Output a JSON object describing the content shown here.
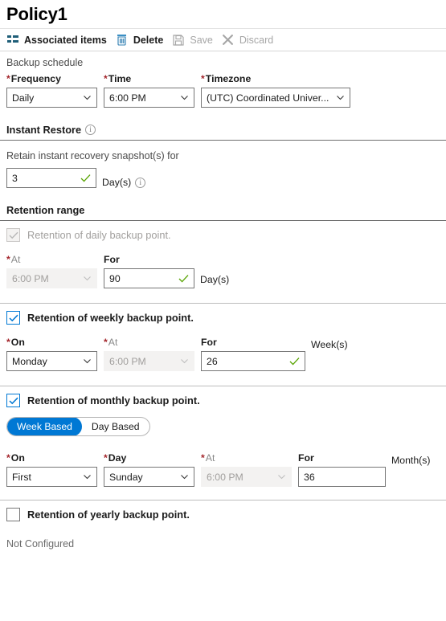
{
  "header": {
    "title": "Policy1"
  },
  "toolbar": {
    "items": [
      {
        "label": "Associated items",
        "icon": "list-icon",
        "disabled": false
      },
      {
        "label": "Delete",
        "icon": "trash-icon",
        "disabled": false
      },
      {
        "label": "Save",
        "icon": "save-icon",
        "disabled": true
      },
      {
        "label": "Discard",
        "icon": "discard-icon",
        "disabled": true
      }
    ]
  },
  "backup_schedule": {
    "section_label": "Backup schedule",
    "frequency": {
      "label": "Frequency",
      "required": true,
      "value": "Daily"
    },
    "time": {
      "label": "Time",
      "required": true,
      "value": "6:00 PM"
    },
    "timezone": {
      "label": "Timezone",
      "required": true,
      "value": "(UTC) Coordinated Univer..."
    }
  },
  "instant_restore": {
    "heading": "Instant Restore",
    "info_icon": "info-icon",
    "retain_label": "Retain instant recovery snapshot(s) for",
    "days_value": "3",
    "days_unit": "Day(s)",
    "days_valid": true
  },
  "retention_range": {
    "heading": "Retention range",
    "daily": {
      "checkbox_label": "Retention of daily backup point.",
      "checked": true,
      "disabled": true,
      "at": {
        "label": "At",
        "required": true,
        "value": "6:00 PM",
        "disabled": true
      },
      "for": {
        "label": "For",
        "required": false,
        "value": "90",
        "valid": true
      },
      "unit": "Day(s)"
    },
    "weekly": {
      "checkbox_label": "Retention of weekly backup point.",
      "checked": true,
      "disabled": false,
      "on": {
        "label": "On",
        "required": true,
        "value": "Monday"
      },
      "at": {
        "label": "At",
        "required": true,
        "value": "6:00 PM",
        "disabled": true
      },
      "for": {
        "label": "For",
        "required": false,
        "value": "26",
        "valid": true
      },
      "unit": "Week(s)"
    },
    "monthly": {
      "checkbox_label": "Retention of monthly backup point.",
      "checked": true,
      "disabled": false,
      "pivot": {
        "options": [
          "Week Based",
          "Day Based"
        ],
        "selected": "Week Based"
      },
      "on": {
        "label": "On",
        "required": true,
        "value": "First"
      },
      "day": {
        "label": "Day",
        "required": true,
        "value": "Sunday"
      },
      "at": {
        "label": "At",
        "required": true,
        "value": "6:00 PM",
        "disabled": true
      },
      "for": {
        "label": "For",
        "required": false,
        "value": "36",
        "valid": false
      },
      "unit": "Month(s)"
    },
    "yearly": {
      "checkbox_label": "Retention of yearly backup point.",
      "checked": false,
      "disabled": false,
      "status": "Not Configured"
    }
  },
  "colors": {
    "accent": "#0078d4",
    "required_star": "#a4262c",
    "valid_tick": "#57a300",
    "disabled_text": "#a19f9d"
  }
}
